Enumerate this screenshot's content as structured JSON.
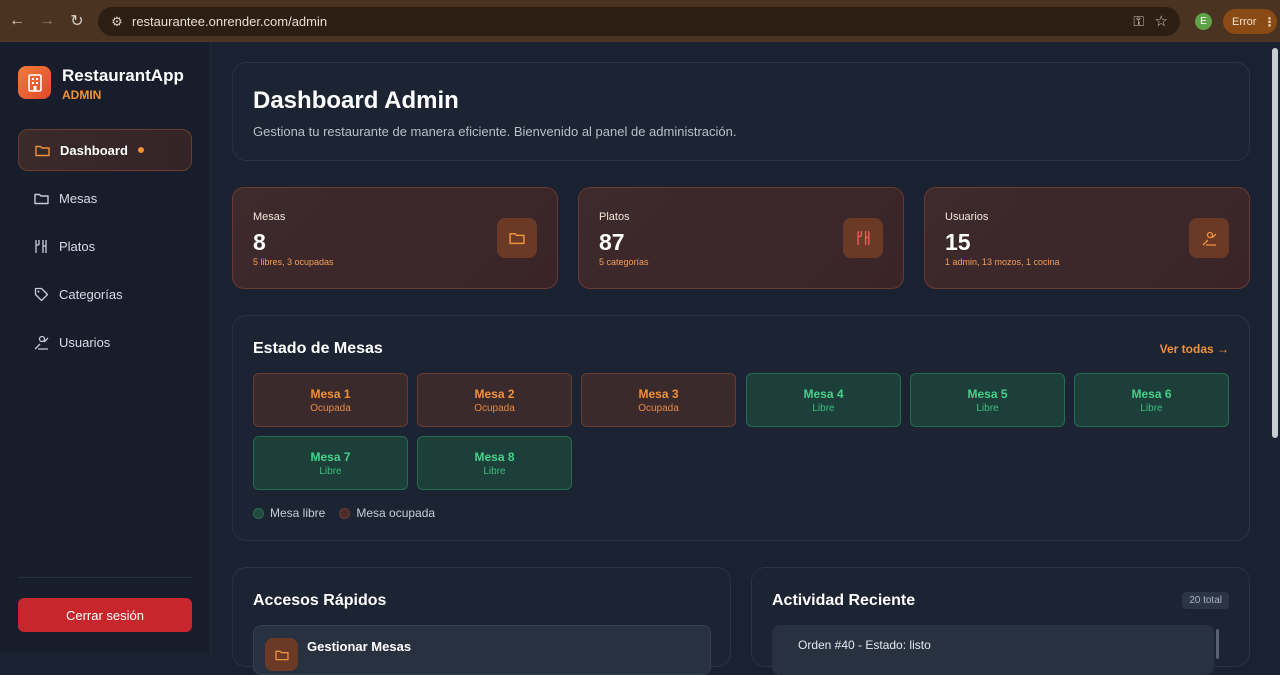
{
  "browser": {
    "url": "restaurantee.onrender.com/admin",
    "profile_initial": "E",
    "error_label": "Error"
  },
  "sidebar": {
    "brand_title": "RestaurantApp",
    "brand_sub": "ADMIN",
    "items": [
      {
        "label": "Dashboard",
        "icon": "folder-icon",
        "active": true
      },
      {
        "label": "Mesas",
        "icon": "folder-icon"
      },
      {
        "label": "Platos",
        "icon": "utensils-icon"
      },
      {
        "label": "Categorías",
        "icon": "tag-icon"
      },
      {
        "label": "Usuarios",
        "icon": "users-icon"
      }
    ],
    "logout_label": "Cerrar sesión"
  },
  "header": {
    "title": "Dashboard Admin",
    "subtitle": "Gestiona tu restaurante de manera eficiente. Bienvenido al panel de administración."
  },
  "stats": [
    {
      "label": "Mesas",
      "value": "8",
      "detail": "5 libres, 3 ocupadas",
      "icon": "folder-icon"
    },
    {
      "label": "Platos",
      "value": "87",
      "detail": "5 categorías",
      "icon": "utensils-icon"
    },
    {
      "label": "Usuarios",
      "value": "15",
      "detail": "1 admin, 13 mozos, 1 cocina",
      "icon": "users-icon"
    }
  ],
  "tables_section": {
    "title": "Estado de Mesas",
    "see_all": "Ver todas →",
    "tables": [
      {
        "name": "Mesa 1",
        "status": "Ocupada"
      },
      {
        "name": "Mesa 2",
        "status": "Ocupada"
      },
      {
        "name": "Mesa 3",
        "status": "Ocupada"
      },
      {
        "name": "Mesa 4",
        "status": "Libre"
      },
      {
        "name": "Mesa 5",
        "status": "Libre"
      },
      {
        "name": "Mesa 6",
        "status": "Libre"
      },
      {
        "name": "Mesa 7",
        "status": "Libre"
      },
      {
        "name": "Mesa 8",
        "status": "Libre"
      }
    ],
    "legend_free": "Mesa libre",
    "legend_busy": "Mesa ocupada"
  },
  "quick_access": {
    "title": "Accesos Rápidos",
    "first_item": "Gestionar Mesas"
  },
  "activity": {
    "title": "Actividad Reciente",
    "count": "20 total",
    "first_item": "Orden #40 - Estado: listo"
  },
  "colors": {
    "accent": "#f0923a",
    "danger": "#c6262c",
    "free": "#47d18a",
    "background": "#1a2231"
  }
}
